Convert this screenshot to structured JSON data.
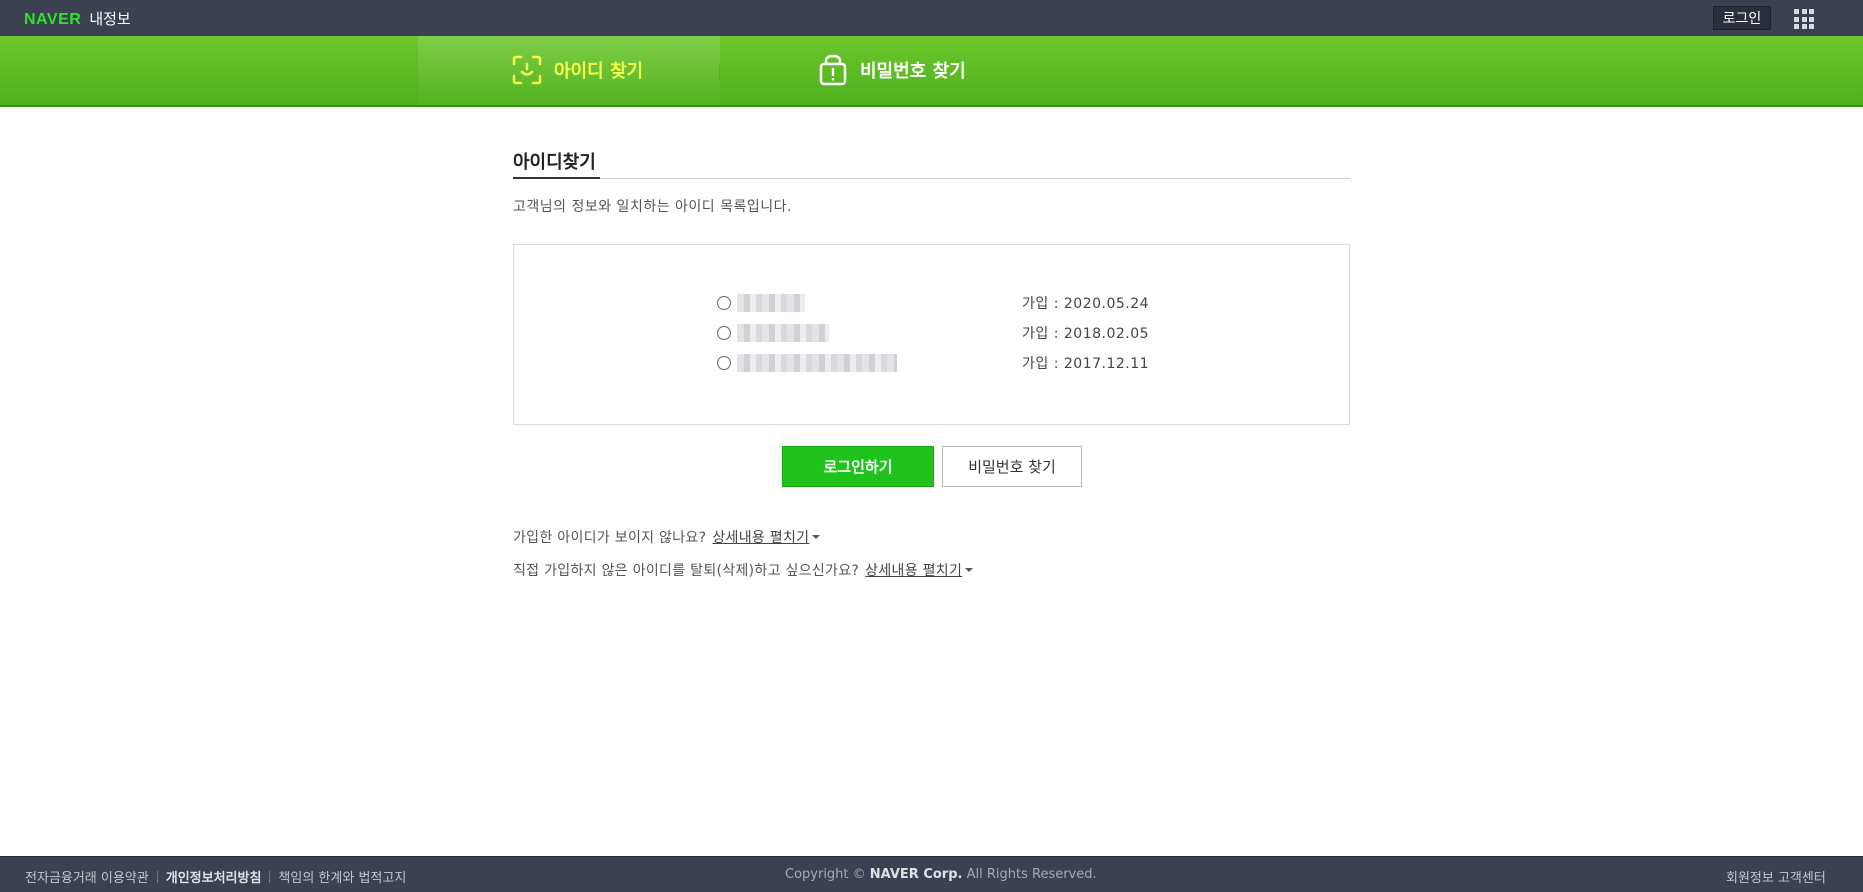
{
  "header": {
    "brand_logo": "NAVER",
    "brand_sub": "내정보",
    "login_label": "로그인",
    "apps_icon": "apps-grid-icon"
  },
  "tabs": [
    {
      "label": "아이디 찾기",
      "icon": "id-scan-icon",
      "active": true
    },
    {
      "label": "비밀번호 찾기",
      "icon": "lock-alert-icon",
      "active": false
    }
  ],
  "main": {
    "title": "아이디찾기",
    "description": "고객님의 정보와 일치하는 아이디 목록입니다.",
    "accounts": [
      {
        "join_date": "가입 : 2020.05.24"
      },
      {
        "join_date": "가입 : 2018.02.05"
      },
      {
        "join_date": "가입 : 2017.12.11"
      }
    ],
    "login_button": "로그인하기",
    "find_pw_button": "비밀번호 찾기",
    "help": [
      {
        "text": "가입한 아이디가 보이지 않나요?",
        "link": "상세내용 펼치기"
      },
      {
        "text": "직접 가입하지 않은 아이디를 탈퇴(삭제)하고 싶으신가요?",
        "link": "상세내용 펼치기"
      }
    ]
  },
  "footer": {
    "links": [
      "전자금융거래 이용약관",
      "개인정보처리방침",
      "책임의 한계와 법적고지"
    ],
    "copyright_prefix": "Copyright ©",
    "copyright_corp": "NAVER Corp.",
    "copyright_suffix": "All Rights Reserved.",
    "right_link": "회원정보 고객센터"
  },
  "colors": {
    "topbar": "#3b4150",
    "green": "#55b41f",
    "active_tab_text": "#f8ff4a",
    "primary_button": "#1fc31b"
  }
}
